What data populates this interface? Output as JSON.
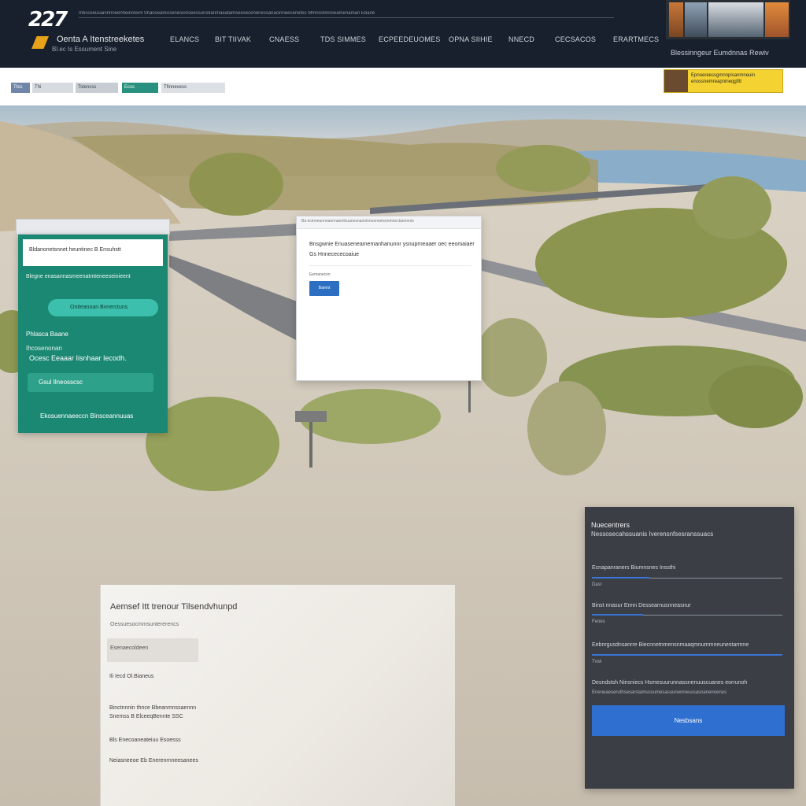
{
  "header": {
    "logo_number": "227",
    "brand_title": "Oenta A Itenstreeketes",
    "brand_subtitle": "Bl.ec Is Essument Sine",
    "top_strip_text": "Inbsceeuuaninnneenheinsteinl   Shanseamicsiinesionseessunstianmaeatamseesecenenessanacinneecenetes   Mmnostinnoeamenaman   Ebane",
    "nav": [
      "Elancs",
      "Bit Tiivak",
      "Cnaess",
      "Tds Simmes",
      "Ecpeedeuomes",
      "Opna Siihie",
      "Nnecd",
      "Cecsacos",
      "Erartmecs"
    ],
    "right_text": "Blessinngeur Eumdnnas Rewiv"
  },
  "subbar": {
    "chips": [
      "Ttcs",
      "Thi",
      "Tstencss",
      "Ecss",
      "Tfinnevess"
    ],
    "promo_text": "Epnoereessgmnnpisanmneuin enossnemreapnineqgfitt"
  },
  "teal_card": {
    "input_text": "Bldanonetsnnet heuntinec B Ensuhstt",
    "line1": "Blegne enasannasmeenatmteneeseinieent",
    "pill_label": "Oniteanoan Bvnerctuns",
    "heading": "Phlasca Baane",
    "subheading": "Ihcosenonan",
    "text": "Ocesc Eeaaar Iisnhaar Iecodh.",
    "button_label": "Gsul Ilneosscsc",
    "footer": "Ekosuennaeeccn Binsceannuuas"
  },
  "dialog": {
    "bar_text": "Ba ectnneunneannnaemhuanesnanninnesnneisonmnectaennnts",
    "line1": "Bnsgwnie Enuaseneamemanhanunnr ysnuprneaaer oec eeomaiaer",
    "line2": "Gs Hnnecececoaiue",
    "small": "Eemanecon",
    "button_label": "Bamnt"
  },
  "dark_panel": {
    "title": "Nuecentrers",
    "subtitle": "Nessosecahssuanis Iverensnfsesranssuacs",
    "fields": [
      {
        "label": "Ecnapanraners Biumnsnes Inssthi",
        "value": "Dasr",
        "accent": 0.3
      },
      {
        "label": "Binst nnasur Ennn Dessearnusnneasnur",
        "value": "Feoes",
        "accent": 0.27
      },
      {
        "label": "Eebnrgusdnsanrre      Biecnnetnmensnmaaqmnummneunestarmne",
        "value": "Tvwi",
        "accent": 1.0
      },
      {
        "label": "Desndstsh Ninsniecs  Hsmesuurunnassnenuuscuanes eorrunoh",
        "value": "Eneneaeseruthsesarstamussumesasuunenneuusasnanennenus",
        "accent": 0
      }
    ],
    "button_label": "Nesbsans"
  },
  "light_card": {
    "title": "Aemsef Itt trenour Tilsendvhunpd",
    "subtitle": "Oessuesocmmsuntererencs",
    "input_text": "Esenaecoldeen",
    "lines": [
      "Ili Iecd Ol.Bianeus",
      "Binctnnnin thnce Bbeanmnssaennn",
      "Snemss B ElceeqBennte SSC",
      "Bls Enecoaneateiuu Esoesss",
      "Neiasneeoe Eb Enerenrnneesanees"
    ]
  },
  "colors": {
    "header_bg": "#17202c",
    "teal": "#1b8873",
    "accent_blue": "#2f6fd0",
    "dark_panel": "#3b3f45",
    "logo_red": "#e23a2e"
  }
}
